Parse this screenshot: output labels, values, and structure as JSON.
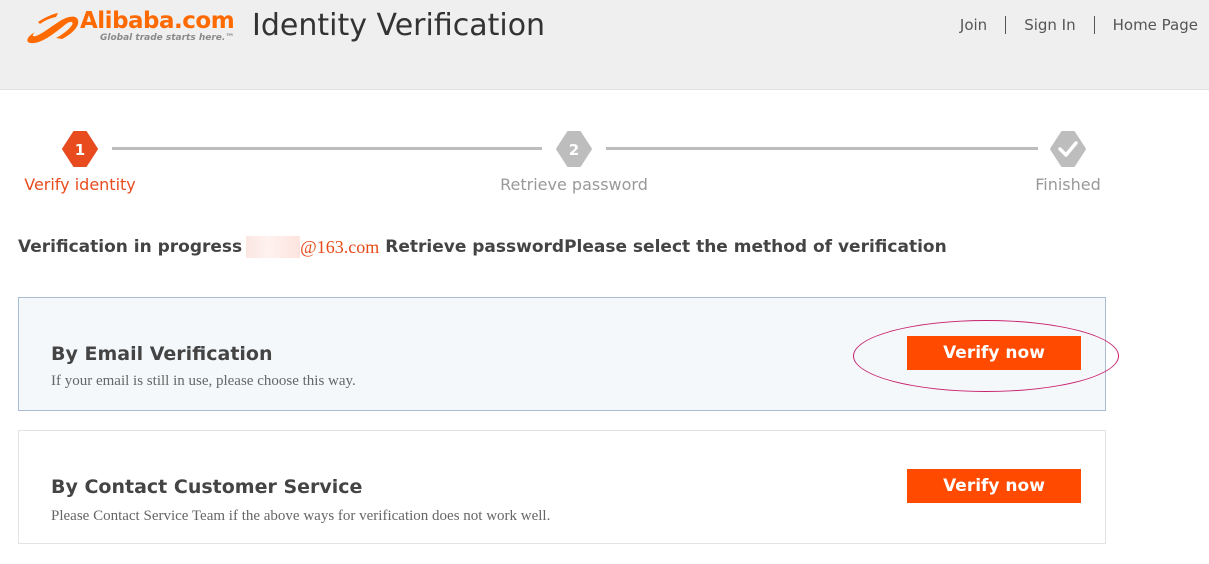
{
  "header": {
    "logo_text": "Alibaba.com",
    "logo_tagline": "Global trade starts here.™",
    "title": "Identity Verification",
    "nav": [
      {
        "label": "Join"
      },
      {
        "label": "Sign In"
      },
      {
        "label": "Home Page"
      }
    ]
  },
  "steps": [
    {
      "number": "1",
      "label": "Verify identity",
      "state": "active",
      "color": "#e84c1e"
    },
    {
      "number": "2",
      "label": "Retrieve password",
      "state": "pending",
      "color": "#bdbdbd"
    },
    {
      "number": "check-icon",
      "label": "Finished",
      "state": "pending",
      "color": "#bdbdbd"
    }
  ],
  "progress": {
    "prefix": "Verification in progress",
    "email_domain": "@163.com",
    "suffix": "Retrieve passwordPlease select the method of verification"
  },
  "options": [
    {
      "title": "By Email Verification",
      "description": "If your email is still in use, please choose this way.",
      "button_label": "Verify now",
      "highlighted": true
    },
    {
      "title": "By Contact Customer Service",
      "description": "Please Contact Service Team if the above ways for verification does not work well.",
      "button_label": "Verify now",
      "highlighted": false
    }
  ],
  "colors": {
    "accent": "#ff4a00",
    "brand": "#ff6a00",
    "annotation": "#c8206e"
  }
}
